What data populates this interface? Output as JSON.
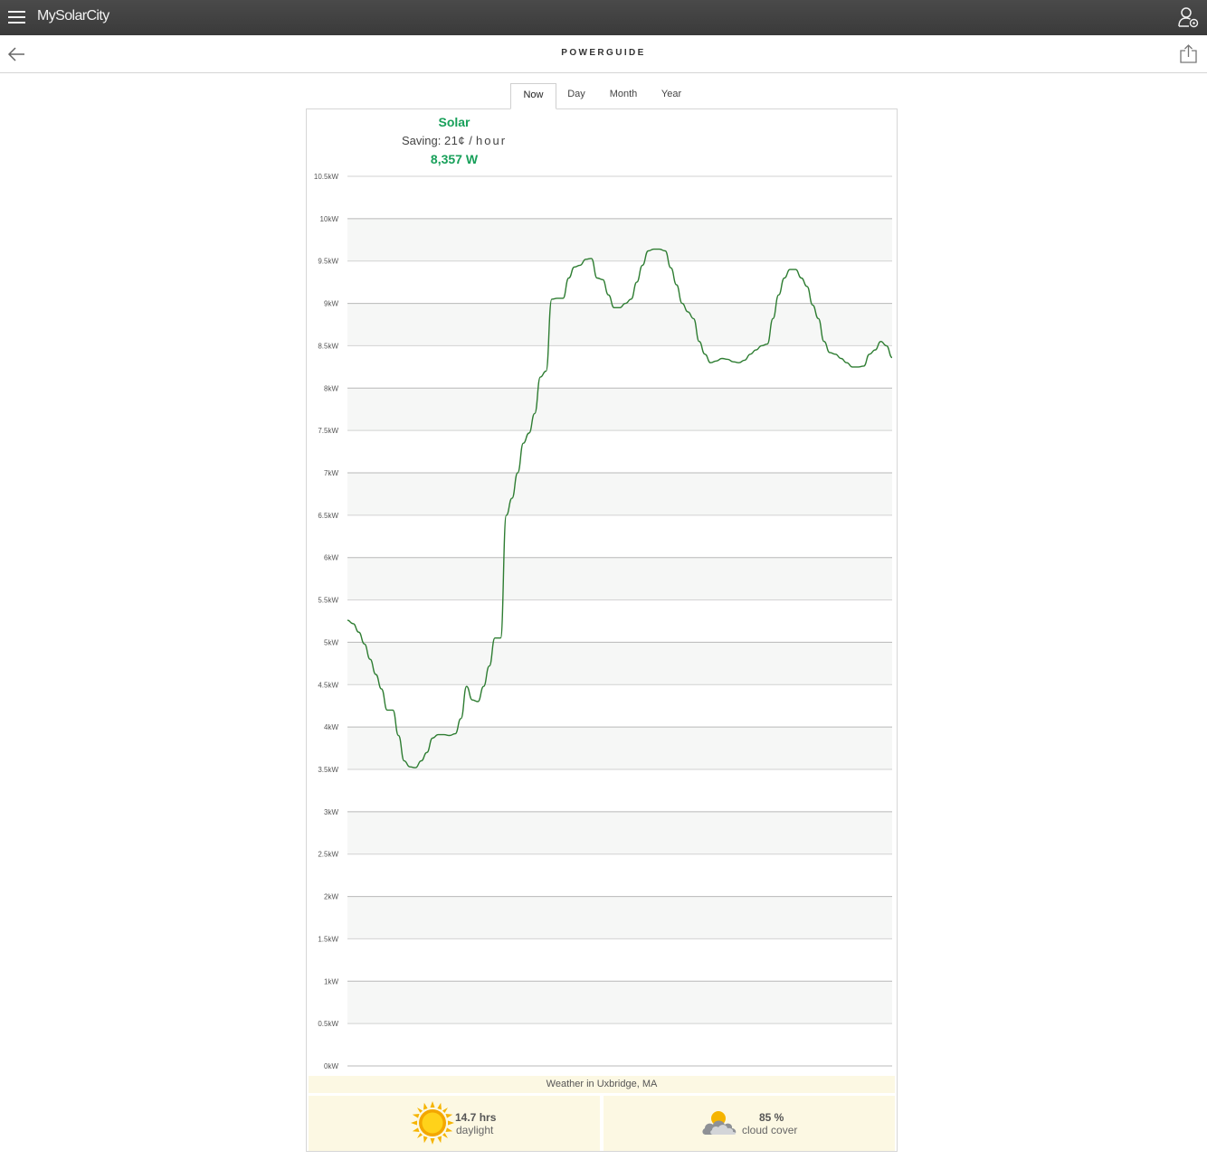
{
  "app": {
    "brand": "MySolarCity"
  },
  "header": {
    "title": "POWERGUIDE"
  },
  "tabs": [
    {
      "label": "Now",
      "active": true
    },
    {
      "label": "Day",
      "active": false
    },
    {
      "label": "Month",
      "active": false
    },
    {
      "label": "Year",
      "active": false
    }
  ],
  "summary": {
    "label": "Solar",
    "saving_label": "Saving:",
    "saving_value": "21¢ /",
    "saving_unit": "hour",
    "watts": "8,357 W"
  },
  "colors": {
    "accent": "#18a05a",
    "line": "#2e7d32",
    "weather_bg": "#fcf8e3",
    "topbar": "#404040"
  },
  "chart_data": {
    "type": "line",
    "ylim": [
      0,
      10.5
    ],
    "yticks": [
      "0kW",
      "0.5kW",
      "1kW",
      "1.5kW",
      "2kW",
      "2.5kW",
      "3kW",
      "3.5kW",
      "4kW",
      "4.5kW",
      "5kW",
      "5.5kW",
      "6kW",
      "6.5kW",
      "7kW",
      "7.5kW",
      "8kW",
      "8.5kW",
      "9kW",
      "9.5kW",
      "10kW",
      "10.5kW"
    ],
    "grid": true,
    "series": [
      {
        "values": [
          5.26,
          5.22,
          5.12,
          4.98,
          4.8,
          4.62,
          4.45,
          4.2,
          4.2,
          3.9,
          3.6,
          3.53,
          3.52,
          3.6,
          3.7,
          3.87,
          3.91,
          3.91,
          3.9,
          3.92,
          4.1,
          4.48,
          4.32,
          4.3,
          4.48,
          4.72,
          5.05,
          5.05,
          6.5,
          6.7,
          7.0,
          7.35,
          7.47,
          7.7,
          8.13,
          8.2,
          9.05,
          9.06,
          9.06,
          9.3,
          9.43,
          9.45,
          9.52,
          9.53,
          9.3,
          9.28,
          9.1,
          8.95,
          8.95,
          9.0,
          9.05,
          9.25,
          9.45,
          9.62,
          9.64,
          9.64,
          9.62,
          9.42,
          9.22,
          9.0,
          8.9,
          8.82,
          8.55,
          8.4,
          8.3,
          8.32,
          8.35,
          8.34,
          8.31,
          8.3,
          8.33,
          8.4,
          8.45,
          8.5,
          8.52,
          8.82,
          9.1,
          9.3,
          9.4,
          9.4,
          9.3,
          9.2,
          8.98,
          8.82,
          8.55,
          8.42,
          8.4,
          8.35,
          8.3,
          8.25,
          8.25,
          8.26,
          8.4,
          8.45,
          8.55,
          8.5,
          8.36
        ]
      }
    ]
  },
  "weather": {
    "title": "Weather in Uxbridge, MA",
    "daylight_value": "14.7 hrs",
    "daylight_label": "daylight",
    "cloud_value": "85 %",
    "cloud_label": "cloud cover"
  },
  "icons": [
    "menu-icon",
    "account-settings-icon",
    "back-arrow-icon",
    "share-icon",
    "sun-icon",
    "partly-cloudy-icon"
  ]
}
